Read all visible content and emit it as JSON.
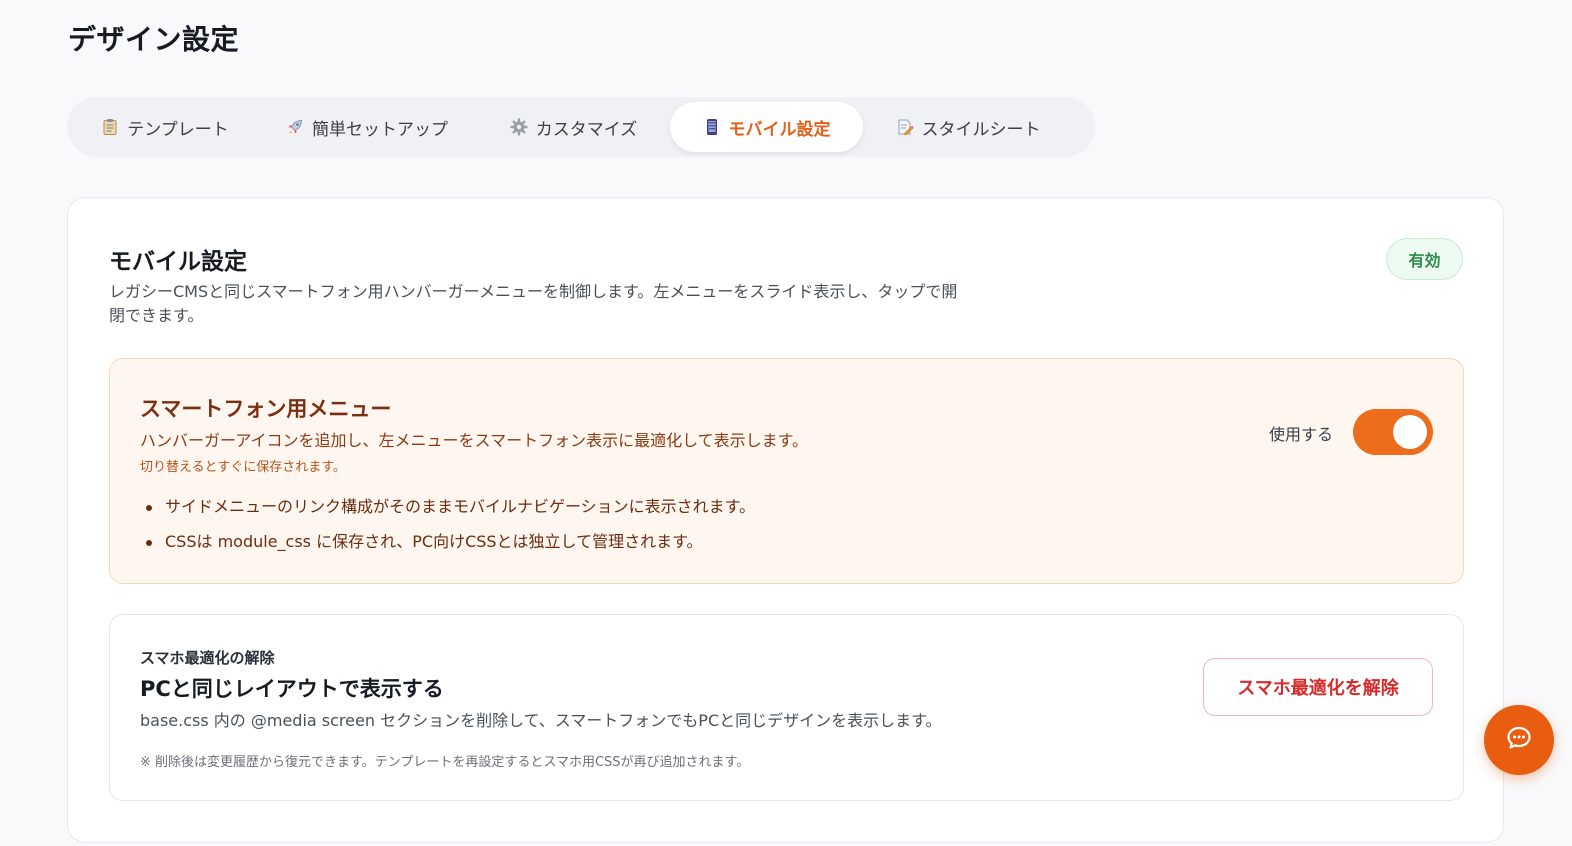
{
  "page": {
    "title": "デザイン設定"
  },
  "tabs": [
    {
      "label": "テンプレート",
      "icon": "clipboard-icon",
      "active": false
    },
    {
      "label": "簡単セットアップ",
      "icon": "rocket-icon",
      "active": false
    },
    {
      "label": "カスタマイズ",
      "icon": "gear-icon",
      "active": false
    },
    {
      "label": "モバイル設定",
      "icon": "mobile-phone-icon",
      "active": true
    },
    {
      "label": "スタイルシート",
      "icon": "memo-icon",
      "active": false
    }
  ],
  "mobile_settings": {
    "title": "モバイル設定",
    "description": "レガシーCMSと同じスマートフォン用ハンバーガーメニューを制御します。左メニューをスライド表示し、タップで開閉できます。",
    "status_badge": "有効",
    "status_color": "#2f8a4a"
  },
  "smartphone_menu": {
    "title": "スマートフォン用メニュー",
    "description": "ハンバーガーアイコンを追加し、左メニューをスマートフォン表示に最適化して表示します。",
    "note": "切り替えるとすぐに保存されます。",
    "bullets": [
      "サイドメニューのリンク構成がそのままモバイルナビゲーションに表示されます。",
      "CSSは module_css に保存され、PC向けCSSとは独立して管理されます。"
    ],
    "toggle_label": "使用する",
    "toggle_on": true,
    "accent_color": "#ee6d1c"
  },
  "reset_optimization": {
    "eyebrow": "スマホ最適化の解除",
    "title": "PCと同じレイアウトで表示する",
    "description": "base.css 内の @media screen セクションを削除して、スマートフォンでもPCと同じデザインを表示します。",
    "note": "※ 削除後は変更履歴から復元できます。テンプレートを再設定するとスマホ用CSSが再び追加されます。",
    "button_label": "スマホ最適化を解除",
    "button_color": "#d82a2a"
  },
  "chat_button": {
    "icon": "chat-bubble-icon"
  }
}
